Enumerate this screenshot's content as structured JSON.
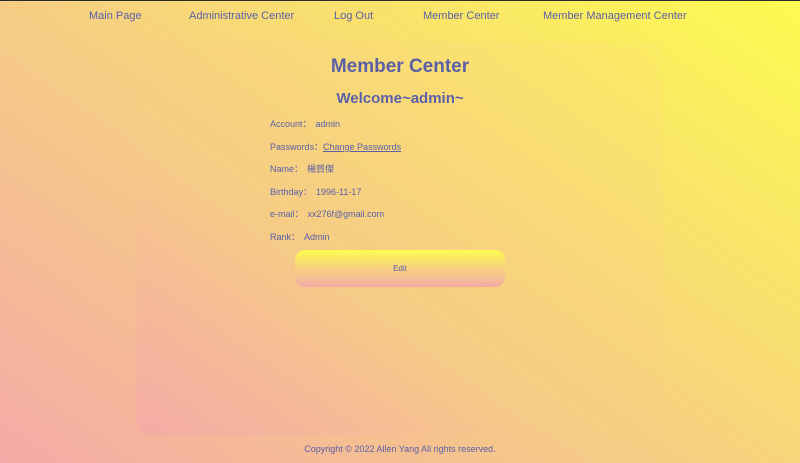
{
  "nav": {
    "items": [
      {
        "label": "Main Page"
      },
      {
        "label": "Administrative Center"
      },
      {
        "label": "Log Out"
      },
      {
        "label": "Member Center"
      },
      {
        "label": "Member Management Center"
      }
    ]
  },
  "page": {
    "title": "Member Center",
    "welcome": "Welcome~admin~"
  },
  "profile": {
    "account_label": "Account：",
    "account_value": "admin",
    "password_label": "Passwords：",
    "password_link": "Change Passwords",
    "name_label": "Name：",
    "name_value": "楊賀傑",
    "birthday_label": "Birthday：",
    "birthday_value": "1996-11-17",
    "email_label": "e-mail：",
    "email_value": "xx276f@gmail.com",
    "rank_label": "Rank：",
    "rank_value": "Admin"
  },
  "actions": {
    "edit_label": "Edit"
  },
  "footer": {
    "copyright": "Copyright © 2022 Allen Yang All rights reserved."
  },
  "colors": {
    "text": "#5a5fa8",
    "gradient_start": "#f4aaa7",
    "gradient_mid": "#f6cd84",
    "gradient_end": "#fdfb50"
  }
}
